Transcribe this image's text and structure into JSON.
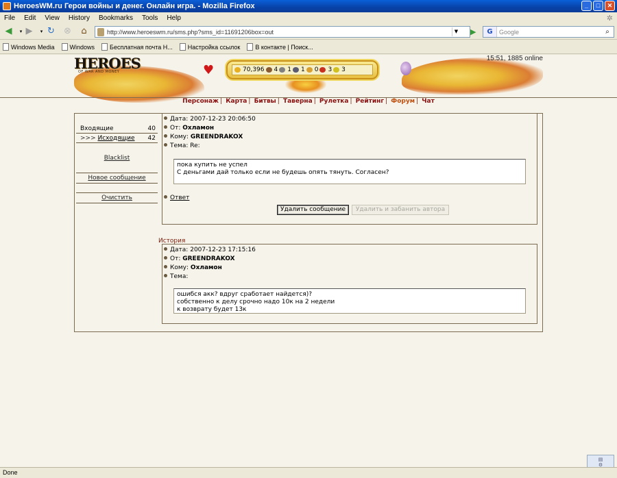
{
  "window": {
    "title": "HeroesWM.ru Герои войны и денег. Онлайн игра. - Mozilla Firefox"
  },
  "menu": [
    "File",
    "Edit",
    "View",
    "History",
    "Bookmarks",
    "Tools",
    "Help"
  ],
  "nav": {
    "url": "http://www.heroeswm.ru/sms.php?sms_id=11691206box=out",
    "search_placeholder": "Google"
  },
  "bookmarks": [
    "Windows Media",
    "Windows",
    "Бесплатная почта H...",
    "Настройка ссылок",
    "В контакте | Поиск..."
  ],
  "header": {
    "logo": "HEROES",
    "logo_sub": "OF WAR AND MONEY",
    "resources": [
      "70,396",
      "4",
      "1",
      "1",
      "0",
      "3",
      "3"
    ],
    "clock": "15:51, 1885 online"
  },
  "toplinks": [
    "Персонаж",
    "Карта",
    "Битвы",
    "Таверна",
    "Рулетка",
    "Рейтинг",
    "Форум",
    "Чат"
  ],
  "sidebar": {
    "inbox_label": "Входящие",
    "inbox_count": "40",
    "outbox_label": "Исходящие",
    "outbox_prefix": ">>>",
    "outbox_count": "42",
    "blacklist": "Blacklist",
    "new_message": "Новое сообщение",
    "clear": "Очистить"
  },
  "message": {
    "date_label": "Дата:",
    "date": "2007-12-23 20:06:50",
    "from_label": "От:",
    "from": "Охламон",
    "to_label": "Кому:",
    "to": "GREENDRAKOX",
    "subject_label": "Тема:",
    "subject": "Re:",
    "body_line1": "пока купить не успел",
    "body_line2": "С деньгами дай только если не будешь опять тянуть. Согласен?",
    "reply_prefix": "Ответ",
    "reply_link": "Ответ",
    "delete_button": "Удалить сообщение",
    "ban_button": "Удалить и забанить автора"
  },
  "history": {
    "label": "История",
    "date_label": "Дата:",
    "date": "2007-12-23 17:15:16",
    "from_label": "От:",
    "from": "GREENDRAKOX",
    "to_label": "Кому:",
    "to": "Охламон",
    "subject_label": "Тема:",
    "body_line1": "ошибся акк? вдруг сработает найдется)?",
    "body_line2": "собственно к делу срочно надо 10к на 2 недели",
    "body_line3": "к возврату будет 13к"
  },
  "status": {
    "text": "Done"
  }
}
